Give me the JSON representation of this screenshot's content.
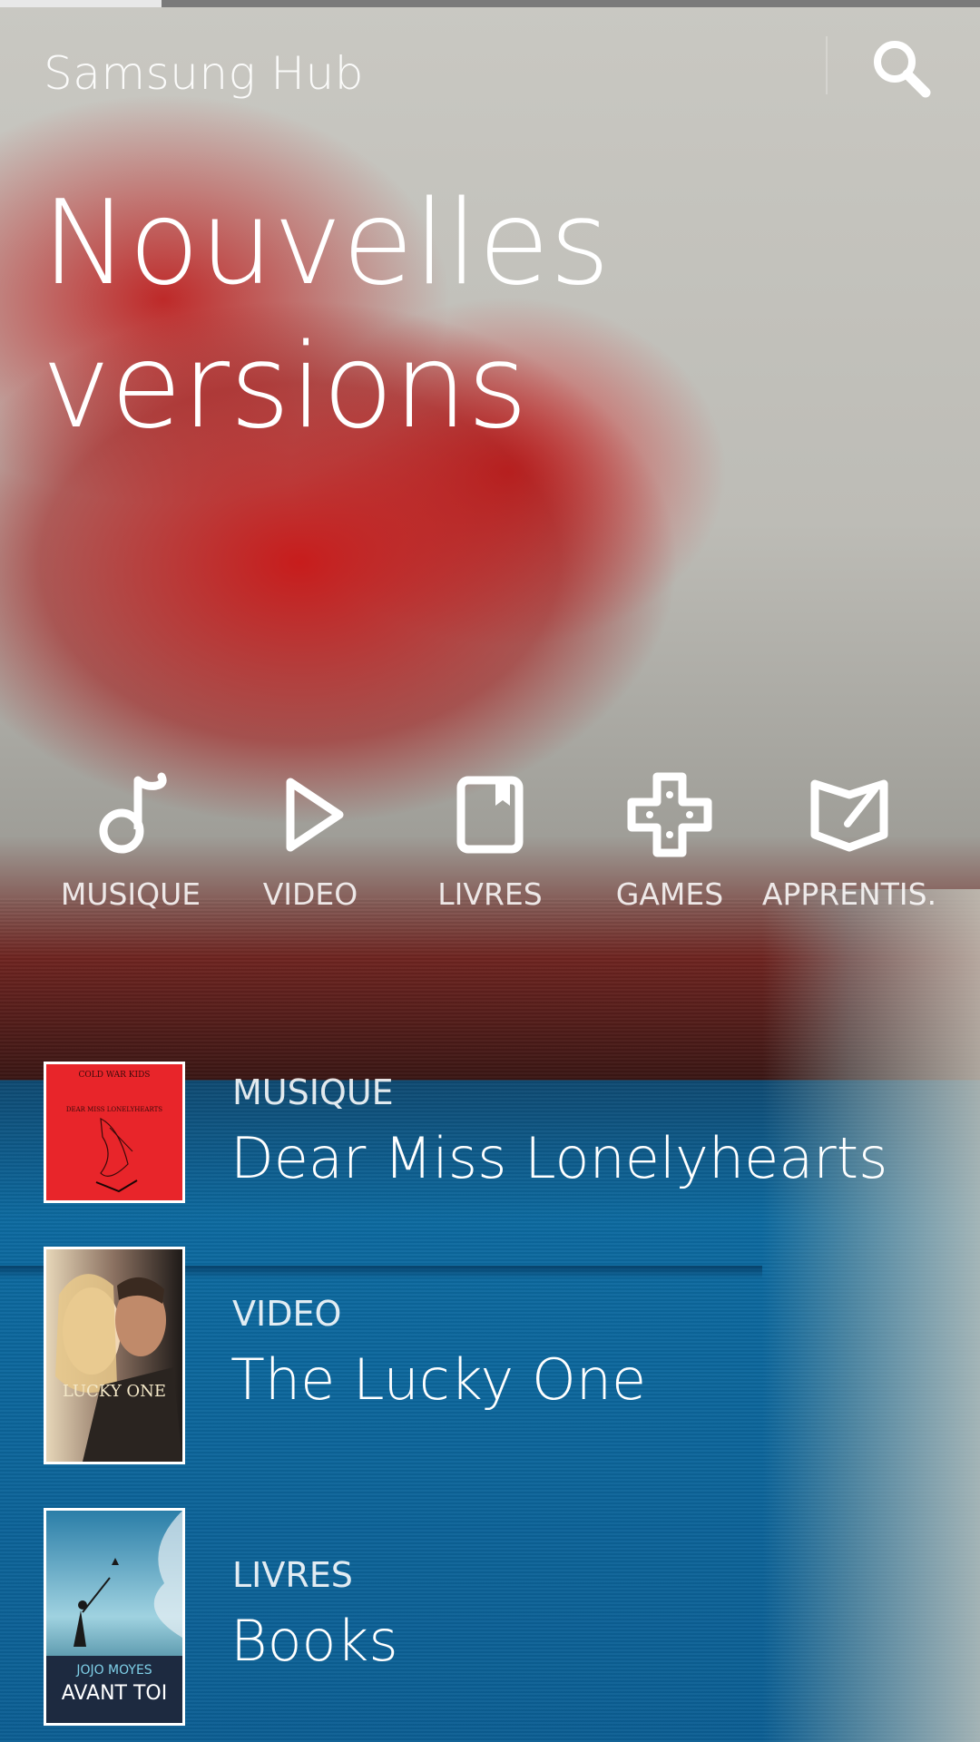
{
  "progress": {
    "value_percent": 16.5,
    "track_color": "#7a7a7a",
    "fill_color": "#e8e8e8"
  },
  "header": {
    "app_title": "Samsung Hub",
    "search_icon": "search-icon"
  },
  "hero": {
    "line1": "Nouvelles",
    "line2": "versions"
  },
  "categories": [
    {
      "label": "MUSIQUE",
      "icon": "music-note-icon"
    },
    {
      "label": "VIDEO",
      "icon": "play-icon"
    },
    {
      "label": "LIVRES",
      "icon": "book-icon"
    },
    {
      "label": "GAMES",
      "icon": "gamepad-cross-icon"
    },
    {
      "label": "APPRENTIS.",
      "icon": "learning-book-icon"
    }
  ],
  "items": [
    {
      "kind": "MUSIQUE",
      "title": "Dear Miss Lonelyhearts",
      "cover": {
        "top_text": "COLD WAR KIDS",
        "sub_text": "DEAR MISS LONELYHEARTS",
        "color": "#e8252a"
      }
    },
    {
      "kind": "VIDEO",
      "title": "The Lucky One",
      "cover": {
        "text": "LUCKY ONE"
      }
    },
    {
      "kind": "LIVRES",
      "title": "Books",
      "cover": {
        "author": "JOJO MOYES",
        "book_title": "AVANT TOI"
      }
    }
  ]
}
